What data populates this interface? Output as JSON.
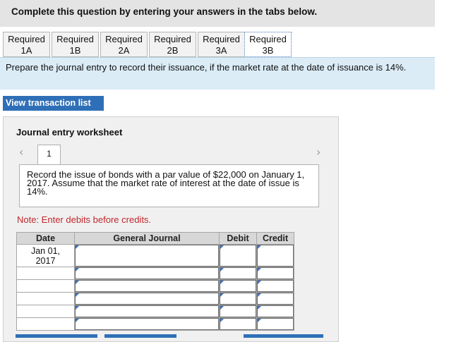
{
  "header": {
    "title": "Complete this question by entering your answers in the tabs below."
  },
  "tabs": [
    {
      "line1": "Required",
      "line2": "1A"
    },
    {
      "line1": "Required",
      "line2": "1B"
    },
    {
      "line1": "Required",
      "line2": "2A"
    },
    {
      "line1": "Required",
      "line2": "2B"
    },
    {
      "line1": "Required",
      "line2": "3A"
    },
    {
      "line1": "Required",
      "line2": "3B"
    }
  ],
  "instruction": "Prepare the journal entry to record their issuance, if the market rate at the date of issuance is 14%.",
  "view_transaction_label": "View transaction list",
  "worksheet": {
    "title": "Journal entry worksheet",
    "page_number": "1",
    "nav_prev_icon": "chevron-left-icon",
    "nav_next_icon": "chevron-right-icon",
    "description": "Record the issue of bonds with a par value of $22,000 on January 1, 2017. Assume that the market rate of interest at the date of issue is 14%.",
    "note": "Note: Enter debits before credits.",
    "columns": {
      "date": "Date",
      "account": "General Journal",
      "debit": "Debit",
      "credit": "Credit"
    },
    "first_row_date": {
      "line1": "Jan 01,",
      "line2": "2017"
    }
  }
}
